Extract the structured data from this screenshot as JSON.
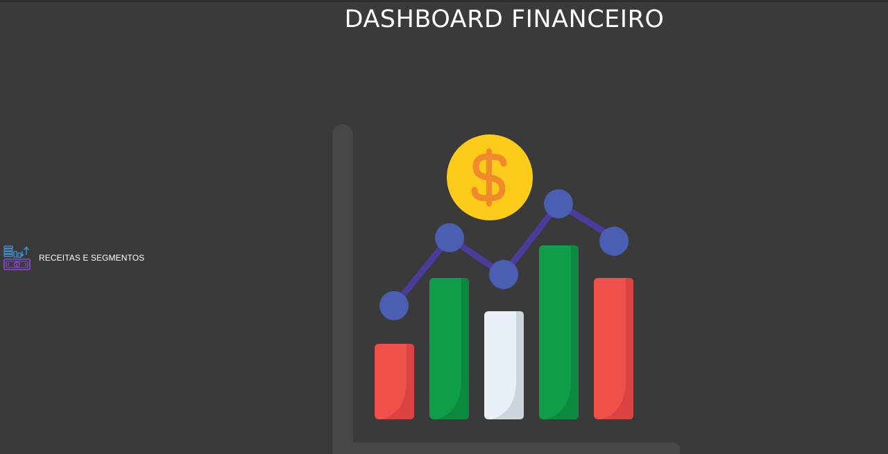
{
  "page": {
    "title": "DASHBOARD FINANCEIRO"
  },
  "nav": {
    "items": [
      {
        "label": "RECEITAS E SEGMENTOS",
        "icon": "finance-growth-icon"
      }
    ]
  },
  "hero": {
    "icon": "financial-chart-illustration",
    "colors": {
      "background": "#3a3a3a",
      "axis": "#474747",
      "red": "#f0504a",
      "red_shade": "#d94341",
      "green": "#0f9d4a",
      "green_shade": "#0b8a3f",
      "white": "#e9f0f7",
      "white_shade": "#cdd5dd",
      "line": "#4a3c9a",
      "dot": "#4b5fb2",
      "coin": "#fdcc1a",
      "dollar": "#f28a2c"
    }
  }
}
